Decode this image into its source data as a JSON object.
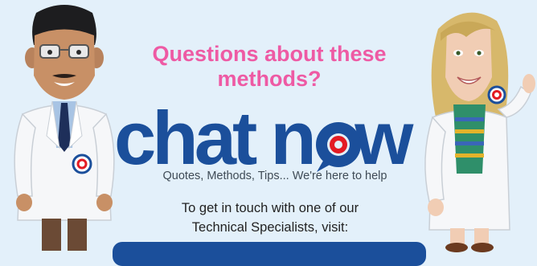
{
  "banner": {
    "question": "Questions about these methods?",
    "logo_text": "chat now",
    "tagline": "Quotes, Methods, Tips... We're here to help",
    "contact_line1": "To get in touch with one of our",
    "contact_line2": "Technical Specialists, visit:"
  },
  "colors": {
    "background": "#e3f0fa",
    "question_pink": "#ee5aa4",
    "logo_blue": "#1b4f9b",
    "badge_red": "#e31b23",
    "coat_white": "#ffffff"
  },
  "icons": {
    "badge": "p-logo-badge-icon",
    "chat_bubble": "chat-bubble-icon"
  }
}
